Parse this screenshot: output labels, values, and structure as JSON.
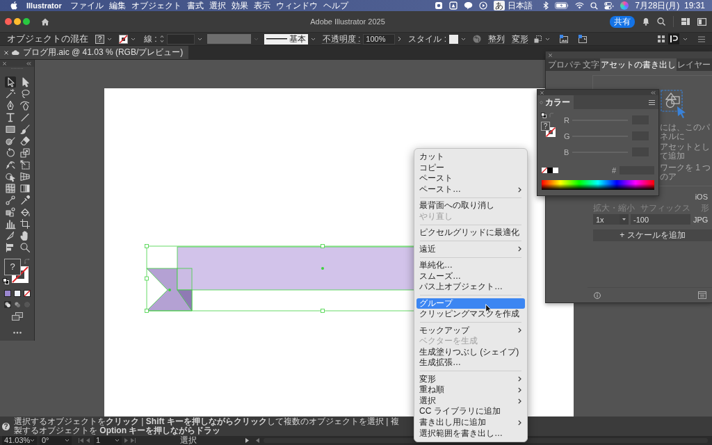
{
  "menubar": {
    "app": "Illustrator",
    "menus": [
      "ファイル",
      "編集",
      "オブジェクト",
      "書式",
      "選択",
      "効果",
      "表示",
      "ウィンドウ",
      "ヘルプ"
    ],
    "input_mode": "あ",
    "input_language": "日本語",
    "clock": "7月28日(月)  19:31"
  },
  "window": {
    "title": "Adobe Illustrator 2025",
    "share_button": "共有"
  },
  "control_bar": {
    "selection_label": "オブジェクトの混在",
    "fill": "?",
    "stroke_label": "線 :",
    "stroke_profile": "基本",
    "opacity_label": "不透明度 :",
    "opacity": "100%",
    "style_label": "スタイル :",
    "align_link": "整列",
    "transform_link": "変形"
  },
  "document_tab": {
    "title": "ブログ用.aic @ 41.03 % (RGB/プレビュー)"
  },
  "toolbar": {
    "tools": [
      {
        "kind": "selection",
        "selected": true
      },
      {
        "kind": "direct",
        "selected": false
      },
      {
        "kind": "wand",
        "selected": false
      },
      {
        "kind": "lasso",
        "selected": false
      },
      {
        "kind": "pen",
        "selected": false
      },
      {
        "kind": "curvature",
        "selected": false
      },
      {
        "kind": "type",
        "selected": false
      },
      {
        "kind": "line",
        "selected": false
      },
      {
        "kind": "rectangle",
        "selected": false
      },
      {
        "kind": "brush",
        "selected": false
      },
      {
        "kind": "shaper",
        "selected": false
      },
      {
        "kind": "eraser",
        "selected": false
      },
      {
        "kind": "rotate",
        "selected": false
      },
      {
        "kind": "scale",
        "selected": false
      },
      {
        "kind": "warp",
        "selected": false
      },
      {
        "kind": "freetransform",
        "selected": false
      },
      {
        "kind": "shapebuilder",
        "selected": false
      },
      {
        "kind": "perspective",
        "selected": false
      },
      {
        "kind": "mesh",
        "selected": false
      },
      {
        "kind": "gradient",
        "selected": false
      },
      {
        "kind": "blend",
        "selected": false
      },
      {
        "kind": "eyedropper",
        "selected": false
      },
      {
        "kind": "symbol",
        "selected": false
      },
      {
        "kind": "livepaint",
        "selected": false
      },
      {
        "kind": "graph",
        "selected": false
      },
      {
        "kind": "artboard",
        "selected": false
      },
      {
        "kind": "slice",
        "selected": false
      },
      {
        "kind": "hand",
        "selected": false
      },
      {
        "kind": "align",
        "selected": false
      },
      {
        "kind": "zoom",
        "selected": false
      }
    ],
    "fill": "?"
  },
  "color_panel": {
    "tab": "カラー",
    "fill": "?",
    "channels": [
      {
        "name": "R"
      },
      {
        "name": "G"
      },
      {
        "name": "B"
      }
    ],
    "hex_label": "#"
  },
  "asset_export_panel": {
    "tabs": [
      {
        "label": "プロパテ",
        "selected": false
      },
      {
        "label": "文字",
        "selected": false
      },
      {
        "label": "アセットの書き出し",
        "selected": true
      },
      {
        "label": "レイヤー",
        "selected": false
      }
    ],
    "hint_lines": [
      "には、このパネルに",
      "アセットとして追加",
      "ワークを 1 つのア"
    ],
    "preset": "iOS",
    "columns": [
      "拡大・縮小",
      "サフィックス",
      "形"
    ],
    "scale": "1x",
    "suffix": "-100",
    "format": "JPG",
    "add_scale_button": "+ スケールを追加"
  },
  "context_menu": {
    "groups": [
      {
        "items": [
          {
            "label": "カット",
            "submenu": false,
            "disabled": false,
            "selected": false
          },
          {
            "label": "コピー",
            "submenu": false,
            "disabled": false,
            "selected": false
          },
          {
            "label": "ペースト",
            "submenu": false,
            "disabled": false,
            "selected": false
          },
          {
            "label": "ペースト…",
            "submenu": true,
            "disabled": false,
            "selected": false
          }
        ]
      },
      {
        "items": [
          {
            "label": "最背面への取り消し",
            "submenu": false,
            "disabled": false,
            "selected": false
          },
          {
            "label": "やり直し",
            "submenu": false,
            "disabled": true,
            "selected": false
          }
        ]
      },
      {
        "items": [
          {
            "label": "ピクセルグリッドに最適化",
            "submenu": false,
            "disabled": false,
            "selected": false
          }
        ]
      },
      {
        "items": [
          {
            "label": "遠近",
            "submenu": true,
            "disabled": false,
            "selected": false
          }
        ]
      },
      {
        "items": [
          {
            "label": "単純化…",
            "submenu": false,
            "disabled": false,
            "selected": false
          },
          {
            "label": "スムーズ…",
            "submenu": false,
            "disabled": false,
            "selected": false
          },
          {
            "label": "パス上オブジェクト…",
            "submenu": false,
            "disabled": false,
            "selected": false
          }
        ]
      },
      {
        "items": [
          {
            "label": "グループ",
            "submenu": false,
            "disabled": false,
            "selected": true
          },
          {
            "label": "クリッピングマスクを作成",
            "submenu": false,
            "disabled": false,
            "selected": false
          }
        ]
      },
      {
        "items": [
          {
            "label": "モックアップ",
            "submenu": true,
            "disabled": false,
            "selected": false
          },
          {
            "label": "ベクターを生成",
            "submenu": false,
            "disabled": true,
            "selected": false
          },
          {
            "label": "生成塗りつぶし (シェイプ)",
            "submenu": false,
            "disabled": false,
            "selected": false
          },
          {
            "label": "生成拡張…",
            "submenu": false,
            "disabled": false,
            "selected": false
          }
        ]
      },
      {
        "items": [
          {
            "label": "変形",
            "submenu": true,
            "disabled": false,
            "selected": false
          },
          {
            "label": "重ね順",
            "submenu": true,
            "disabled": false,
            "selected": false
          },
          {
            "label": "選択",
            "submenu": true,
            "disabled": false,
            "selected": false
          },
          {
            "label": "CC ライブラリに追加",
            "submenu": false,
            "disabled": false,
            "selected": false
          },
          {
            "label": "書き出し用に追加",
            "submenu": true,
            "disabled": false,
            "selected": false
          },
          {
            "label": "選択範囲を書き出し…",
            "submenu": false,
            "disabled": false,
            "selected": false
          }
        ]
      }
    ]
  },
  "status_bar": {
    "help_icon": "?",
    "message": "選択するオブジェクトを**クリック** | **Shift キーを押しながらクリック**して複数のオブジェクトを選択 | 複製するオブジェクトを **Option キーを押しながらドラッ**"
  },
  "bottom_bar": {
    "zoom": "41.03%",
    "rotation": "0°",
    "artboard": "1",
    "tool": "選択"
  }
}
